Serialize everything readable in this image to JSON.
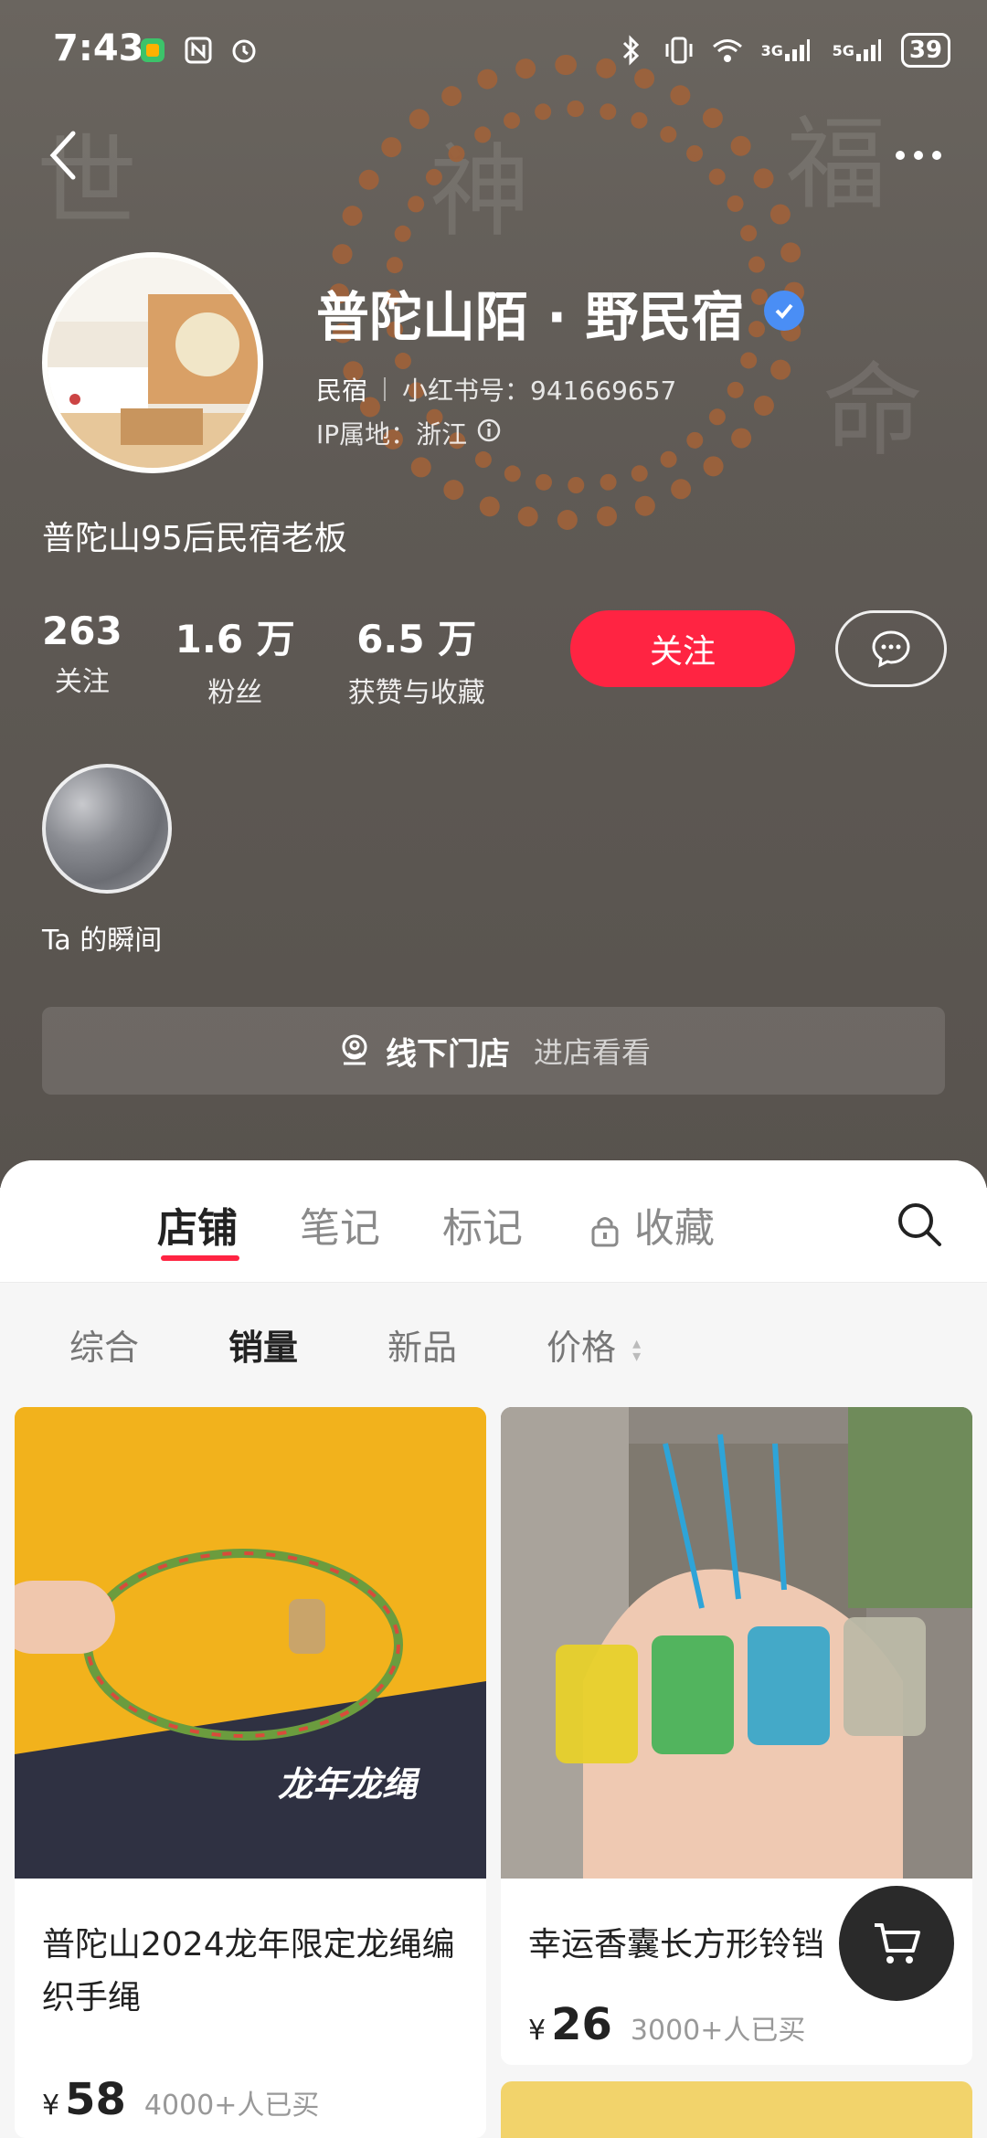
{
  "status": {
    "time": "7:43",
    "battery": "39",
    "net3g": "3G",
    "net5g": "5G"
  },
  "profile": {
    "name": "普陀山陌 · 野民宿",
    "category": "民宿",
    "redbook_id": "小红书号：941669657",
    "ip_location": "IP属地：浙江",
    "bio": "普陀山95后民宿老板"
  },
  "stats": [
    {
      "num": "263",
      "label": "关注"
    },
    {
      "num": "1.6 万",
      "label": "粉丝"
    },
    {
      "num": "6.5 万",
      "label": "获赞与收藏"
    }
  ],
  "actions": {
    "follow": "关注"
  },
  "moment": {
    "label": "Ta 的瞬间"
  },
  "store_bar": {
    "title": "线下门店",
    "subtitle": "进店看看"
  },
  "tabs": [
    {
      "label": "店铺",
      "active": true
    },
    {
      "label": "笔记",
      "active": false
    },
    {
      "label": "标记",
      "active": false
    },
    {
      "label": "收藏",
      "active": false
    }
  ],
  "sorts": [
    {
      "label": "综合",
      "active": false
    },
    {
      "label": "销量",
      "active": true
    },
    {
      "label": "新品",
      "active": false
    },
    {
      "label": "价格",
      "active": false
    }
  ],
  "products": [
    {
      "title": "普陀山2024龙年限定龙绳编织手绳",
      "image_text": "龙年龙绳",
      "currency": "¥",
      "price": "58",
      "sold": "4000+人已买"
    },
    {
      "title": "幸运香囊长方形铃铛",
      "currency": "¥",
      "price": "26",
      "sold": "3000+人已买"
    }
  ],
  "background_text": [
    "世",
    "福",
    "神",
    "命"
  ],
  "colors": {
    "accent": "#ff2442",
    "verify": "#4a8ef5"
  }
}
